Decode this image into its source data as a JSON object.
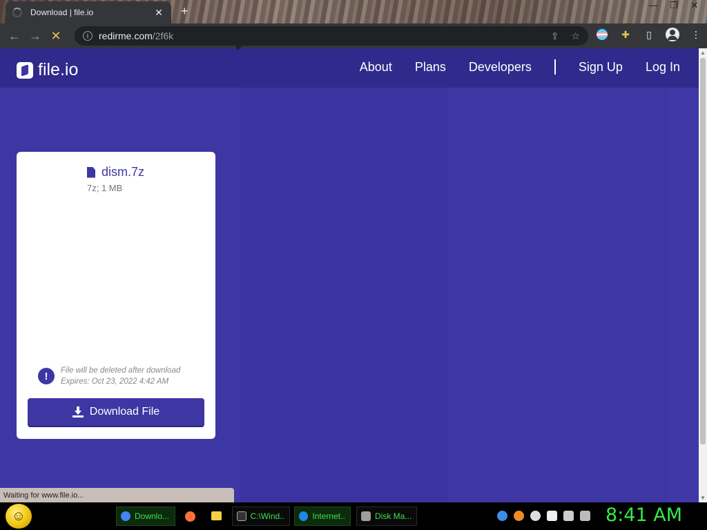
{
  "browser": {
    "tab_title": "Download | file.io",
    "tab_close": "✕",
    "new_tab": "+",
    "url_host": "redirme.com",
    "url_path": "/2f6k",
    "status_text": "Waiting for www.file.io..."
  },
  "site": {
    "logo_text": "file.io",
    "nav": [
      {
        "label": "About"
      },
      {
        "label": "Plans"
      },
      {
        "label": "Developers"
      },
      {
        "label": "Sign Up"
      },
      {
        "label": "Log In"
      }
    ]
  },
  "file": {
    "name": "dism.7z",
    "meta": "7z; 1 MB",
    "notice_line1": "File will be deleted after download",
    "notice_line2": "Expires: Oct 23, 2022 4:42 AM",
    "download_label": "Download File"
  },
  "taskbar": {
    "tasks": [
      {
        "label": "Downlo...",
        "color": "#4285f4"
      },
      {
        "label": "C:\\Wind...",
        "color": "#888888"
      },
      {
        "label": "Internet...",
        "color": "#1e88e5"
      },
      {
        "label": "Disk Ma...",
        "color": "#9e9e9e"
      }
    ],
    "clock": "8:41 AM"
  },
  "colors": {
    "brand": "#3d36a3",
    "navbar": "#302a8c",
    "clock": "#35e84a"
  }
}
